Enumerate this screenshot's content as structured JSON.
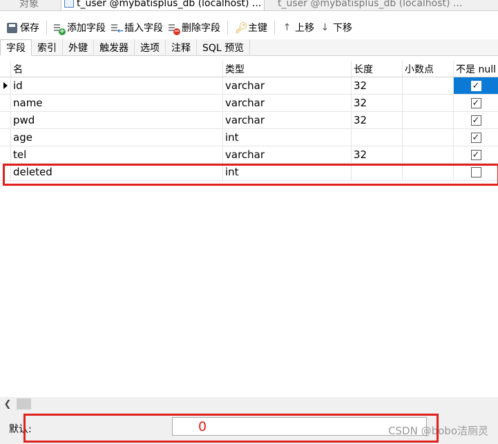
{
  "tabs": [
    {
      "label": "对象",
      "active": false
    },
    {
      "label": "t_user @mybatisplus_db (localhost) ...",
      "active": true,
      "icon": "table-design-icon"
    },
    {
      "label": "t_user @mybatisplus_db (localhost) ...",
      "active": false,
      "icon": "table-grid-icon"
    }
  ],
  "toolbar": {
    "save": "保存",
    "add_field": "添加字段",
    "insert_field": "插入字段",
    "delete_field": "删除字段",
    "primary_key": "主键",
    "move_up": "上移",
    "move_down": "下移"
  },
  "subtabs": [
    "字段",
    "索引",
    "外键",
    "触发器",
    "选项",
    "注释",
    "SQL 预览"
  ],
  "grid": {
    "columns": [
      "名",
      "类型",
      "长度",
      "小数点",
      "不是 null"
    ],
    "rows": [
      {
        "name": "id",
        "type": "varchar",
        "length": "32",
        "decimals": "",
        "not_null": true
      },
      {
        "name": "name",
        "type": "varchar",
        "length": "32",
        "decimals": "",
        "not_null": true
      },
      {
        "name": "pwd",
        "type": "varchar",
        "length": "32",
        "decimals": "",
        "not_null": true
      },
      {
        "name": "age",
        "type": "int",
        "length": "",
        "decimals": "",
        "not_null": true
      },
      {
        "name": "tel",
        "type": "varchar",
        "length": "32",
        "decimals": "",
        "not_null": true
      },
      {
        "name": "deleted",
        "type": "int",
        "length": "",
        "decimals": "",
        "not_null": false
      }
    ]
  },
  "props": {
    "default_label": "默认:",
    "default_value": "0"
  },
  "watermark": "CSDN @bobo洁厕灵",
  "colors": {
    "highlight": "#e0201d",
    "selection": "#0a7ad6"
  }
}
